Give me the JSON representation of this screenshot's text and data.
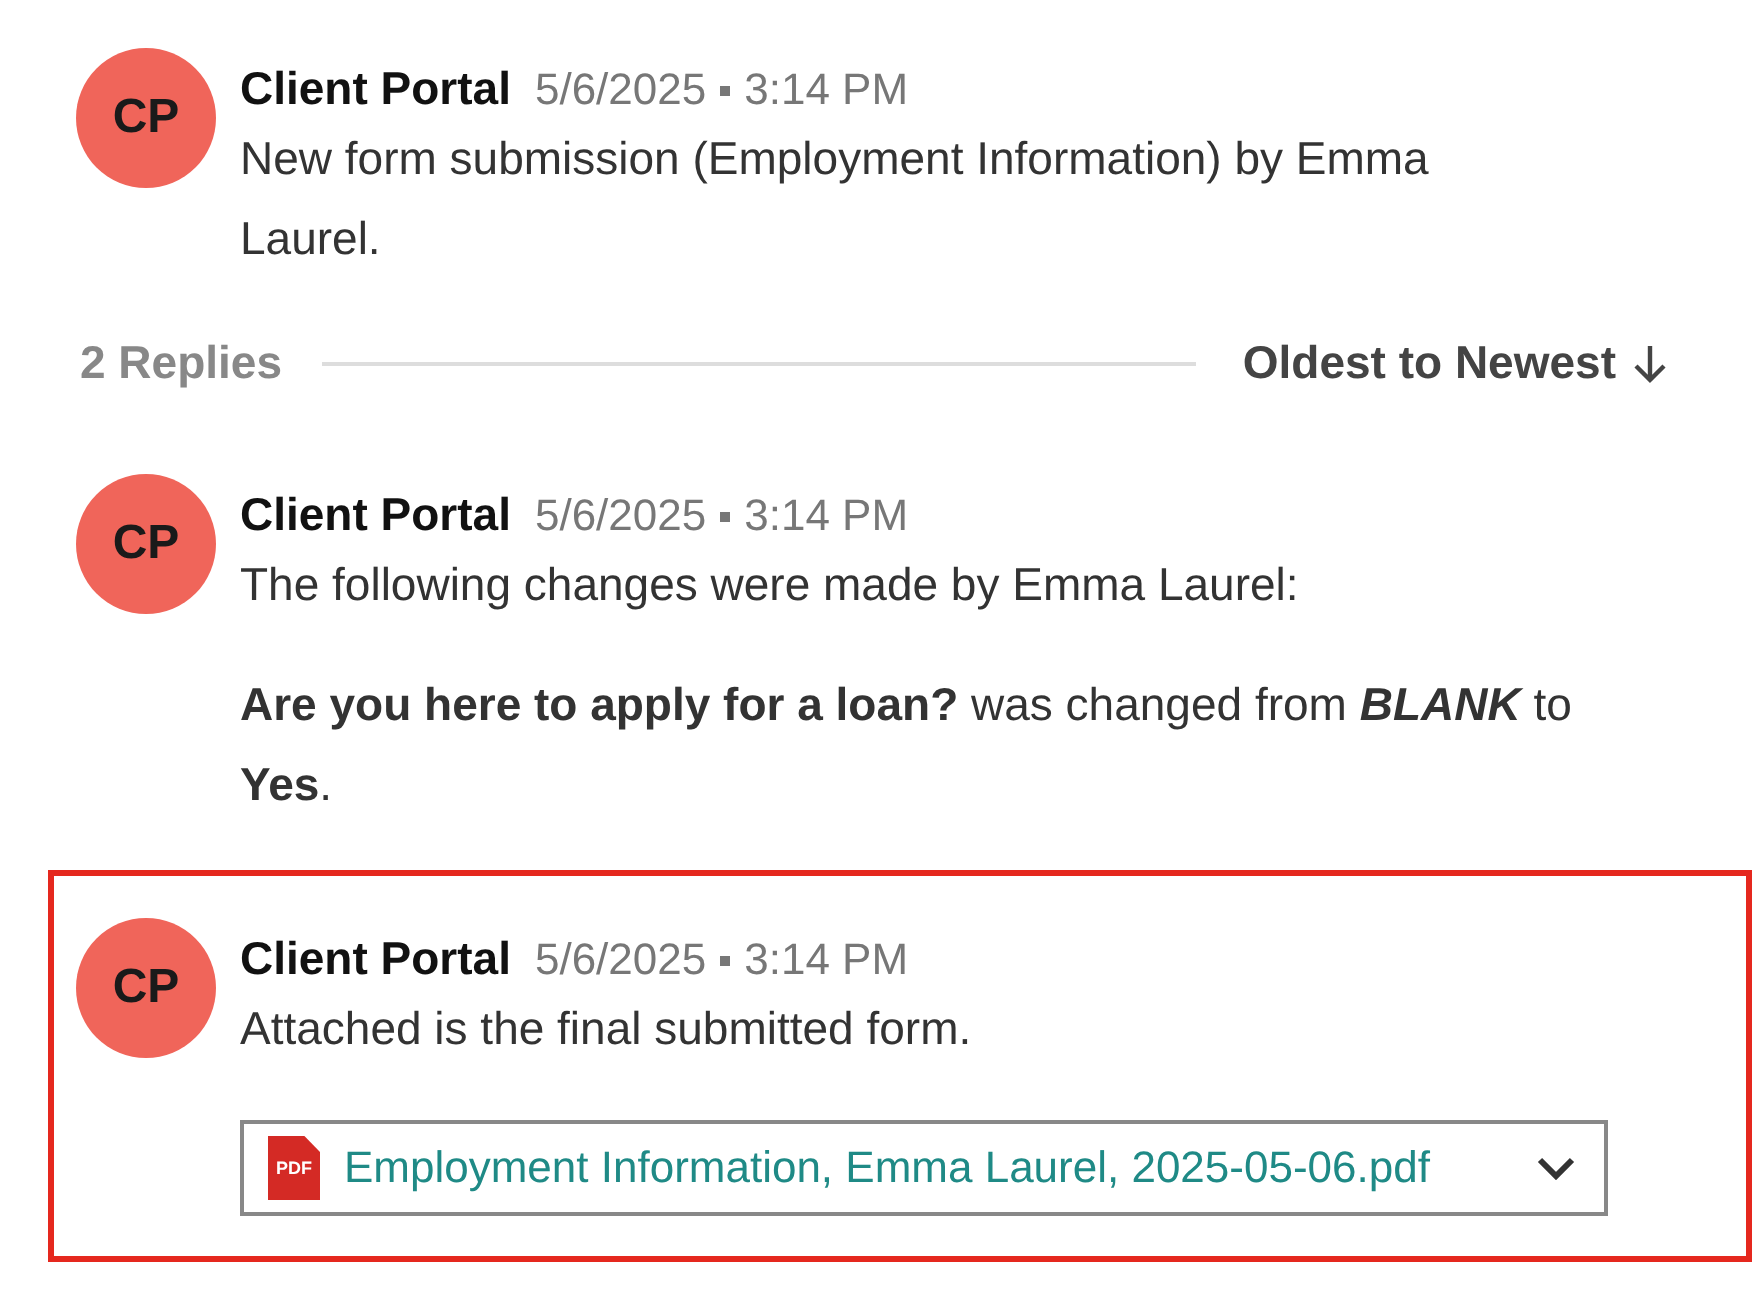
{
  "messages_top": [
    {
      "avatar": "CP",
      "author": "Client Portal",
      "date": "5/6/2025",
      "time": "3:14 PM",
      "highlighted": false,
      "paragraphs": [
        "New form submission (Employment Information) by Emma Laurel."
      ]
    }
  ],
  "replies_bar": {
    "count": "2 Replies",
    "sort": "Oldest to Newest"
  },
  "replies": [
    {
      "avatar": "CP",
      "author": "Client Portal",
      "date": "5/6/2025",
      "time": "3:14 PM",
      "highlighted": false,
      "paragraphs": [
        "The following changes were made by Emma Laurel:",
        "**Are you here to apply for a loan?** was changed from *BLANK* to **Yes**."
      ]
    },
    {
      "avatar": "CP",
      "author": "Client Portal",
      "date": "5/6/2025",
      "time": "3:14 PM",
      "highlighted": true,
      "paragraphs": [
        "Attached is the final submitted form."
      ],
      "attachment": {
        "file_type": "PDF",
        "name": "Employment Information, Emma Laurel, 2025-05-06.pdf"
      }
    }
  ]
}
